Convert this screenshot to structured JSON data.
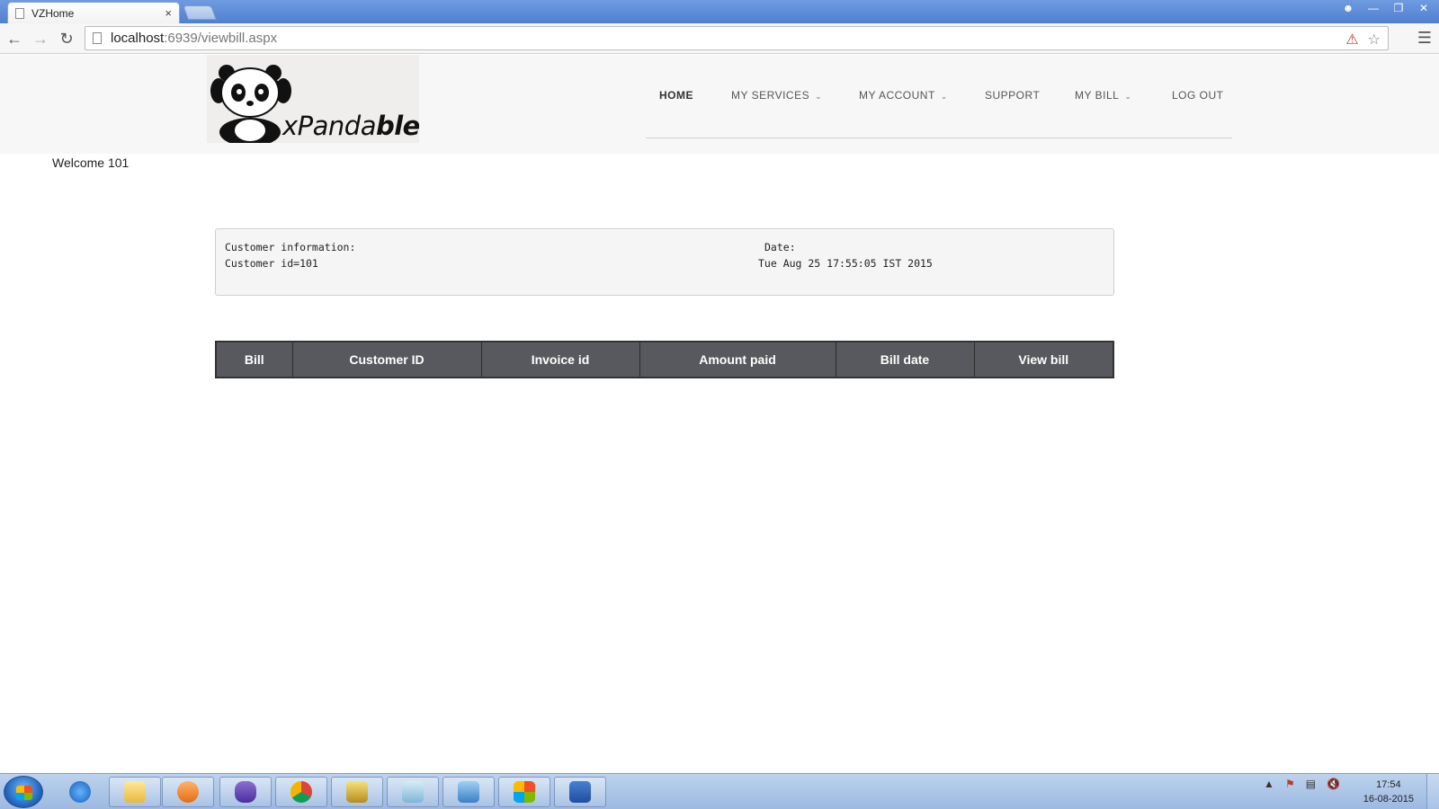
{
  "browser": {
    "tab_title": "VZHome",
    "tab_close": "×",
    "url_host": "localhost",
    "url_path": ":6939/viewbill.aspx"
  },
  "site": {
    "logo_text_light": "xPanda",
    "logo_text_bold": "ble",
    "nav": [
      {
        "label": "HOME"
      },
      {
        "label": "MY SERVICES"
      },
      {
        "label": "MY ACCOUNT"
      },
      {
        "label": "SUPPORT"
      },
      {
        "label": "MY BILL"
      },
      {
        "label": "LOG OUT"
      }
    ],
    "welcome": "Welcome 101"
  },
  "customer_info": {
    "heading": "Customer information:",
    "id_line": "Customer id=101",
    "date_label": "Date:",
    "date_value": "Tue Aug 25 17:55:05 IST 2015"
  },
  "bill_table": {
    "headers": [
      "Bill",
      "Customer ID",
      "Invoice id",
      "Amount paid",
      "Bill date",
      "View bill"
    ]
  },
  "taskbar": {
    "time": "17:54",
    "date": "16-08-2015",
    "apps": [
      "internet-explorer",
      "file-explorer",
      "media-player",
      "visual-studio",
      "chrome",
      "snipping-tool",
      "notepad",
      "control-panel",
      "security",
      "word"
    ]
  }
}
